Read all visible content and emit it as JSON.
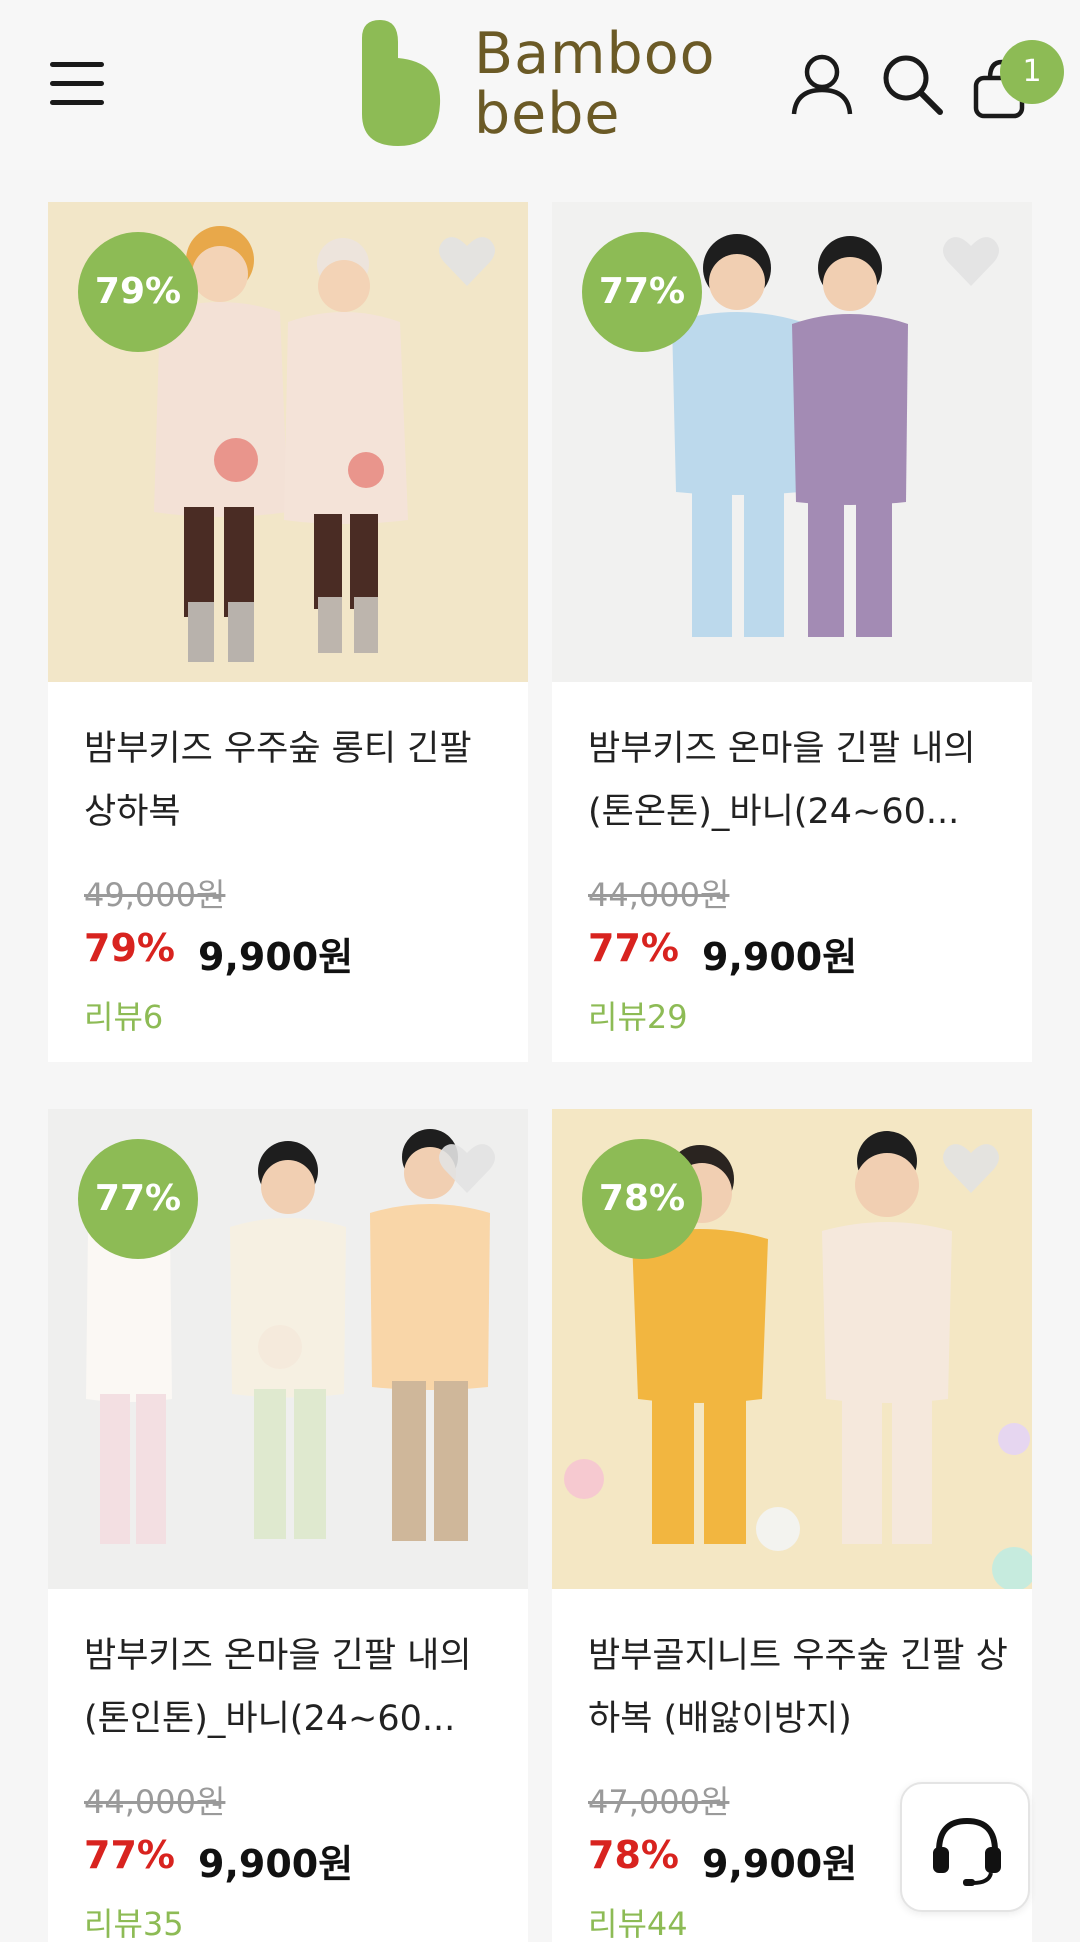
{
  "header": {
    "logo_line1": "Bamboo",
    "logo_line2": "bebe",
    "cart_count": "1",
    "icons": [
      "menu-icon",
      "user-icon",
      "search-icon",
      "shopping-bag-icon"
    ]
  },
  "colors": {
    "brand_green": "#8dbb55",
    "brand_brown": "#6b5a26",
    "sale_red": "#d8231f"
  },
  "products": [
    {
      "badge": "79%",
      "name": "밤부키즈 우주숲 롱티 긴팔 상하복",
      "original_price": "49,000원",
      "discount_rate": "79%",
      "price": "9,900원",
      "review": "리뷰6"
    },
    {
      "badge": "77%",
      "name": "밤부키즈 온마을 긴팔 내의 (톤온톤)_바니(24~60...",
      "original_price": "44,000원",
      "discount_rate": "77%",
      "price": "9,900원",
      "review": "리뷰29"
    },
    {
      "badge": "77%",
      "name": "밤부키즈 온마을 긴팔 내의 (톤인톤)_바니(24~60...",
      "original_price": "44,000원",
      "discount_rate": "77%",
      "price": "9,900원",
      "review": "리뷰35"
    },
    {
      "badge": "78%",
      "name": "밤부골지니트 우주숲 긴팔 상하복 (배앓이방지)",
      "original_price": "47,000원",
      "discount_rate": "78%",
      "price": "9,900원",
      "review": "리뷰44"
    }
  ]
}
